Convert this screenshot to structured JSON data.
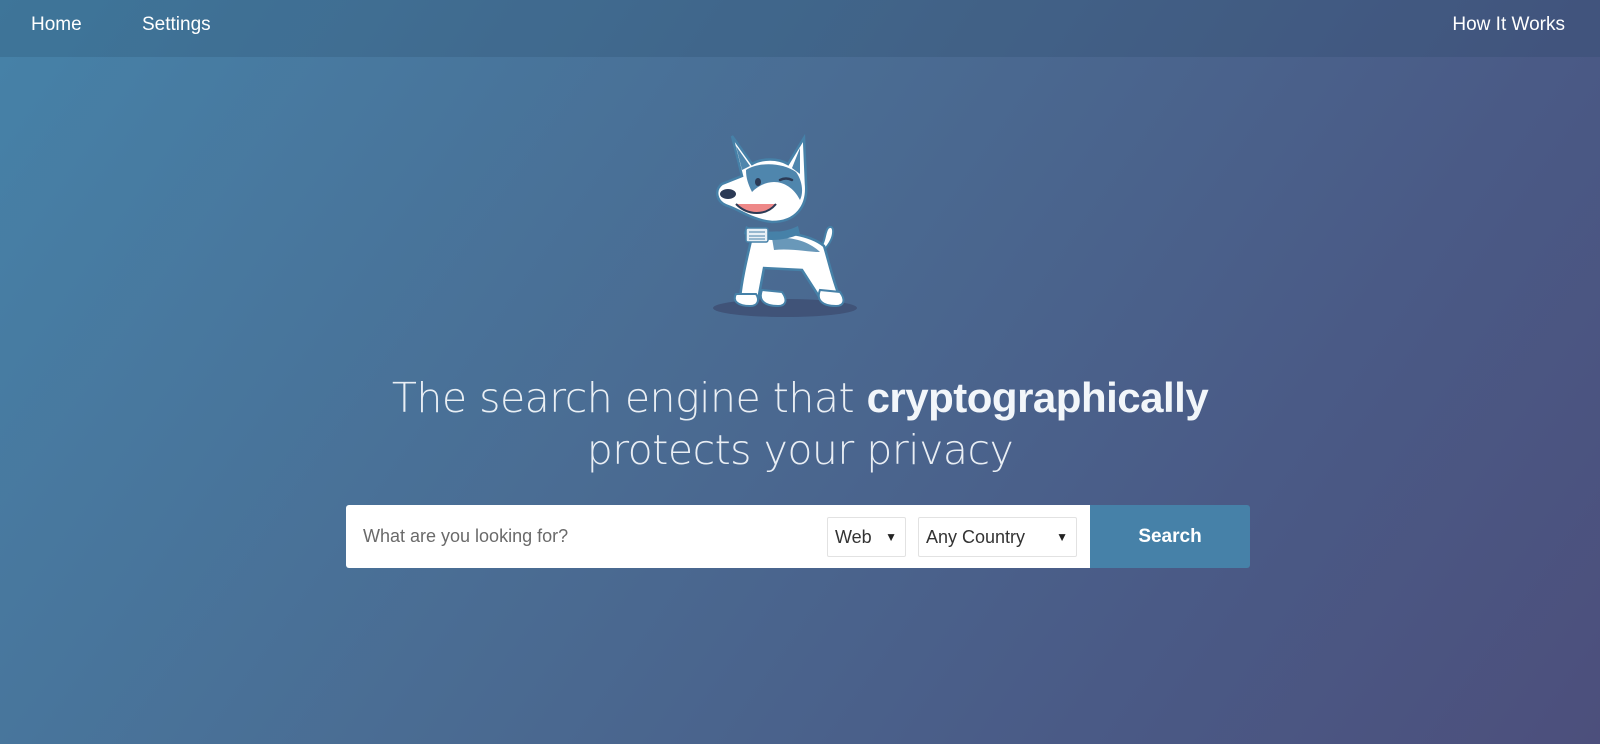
{
  "nav": {
    "home_label": "Home",
    "settings_label": "Settings",
    "how_label": "How It Works"
  },
  "hero": {
    "line1_prefix": "The search engine that ",
    "line1_bold": "cryptographically",
    "line2": "protects your privacy"
  },
  "search": {
    "placeholder": "What are you looking for?",
    "type_value": "Web",
    "country_value": "Any Country",
    "button_label": "Search"
  },
  "icons": {
    "mascot": "husky-dog-mascot-icon",
    "caret": "caret-down-icon"
  },
  "colors": {
    "accent": "#4681a8",
    "background_start": "#4682a8",
    "background_end": "#4c4f7c"
  }
}
